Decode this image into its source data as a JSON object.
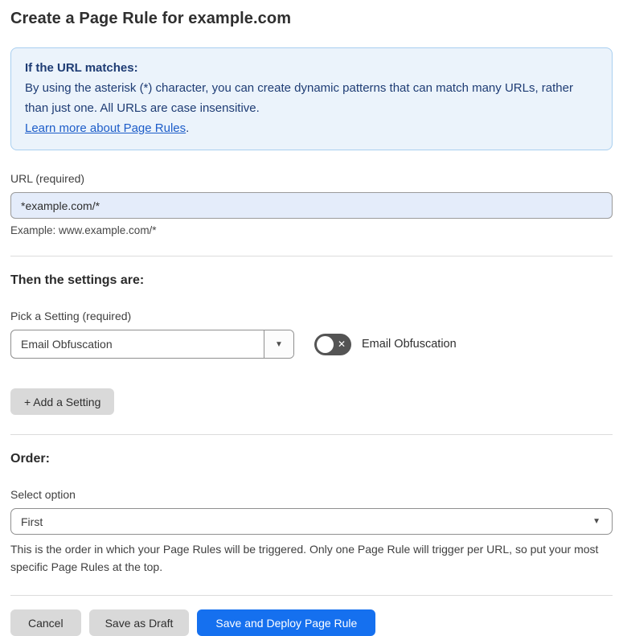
{
  "page": {
    "title": "Create a Page Rule for example.com"
  },
  "info_box": {
    "heading": "If the URL matches:",
    "body": "By using the asterisk (*) character, you can create dynamic patterns that can match many URLs, rather than just one. All URLs are case insensitive.",
    "link": "Learn more about Page Rules",
    "link_suffix": "."
  },
  "url_field": {
    "label": "URL (required)",
    "value": "*example.com/*",
    "helper": "Example: www.example.com/*"
  },
  "settings": {
    "heading": "Then the settings are:",
    "picker_label": "Pick a Setting (required)",
    "picker_value": "Email Obfuscation",
    "toggle_label": "Email Obfuscation",
    "toggle_state": "off",
    "add_button_label": "+ Add a Setting"
  },
  "order": {
    "heading": "Order:",
    "select_label": "Select option",
    "select_value": "First",
    "helper": "This is the order in which your Page Rules will be triggered. Only one Page Rule will trigger per URL, so put your most specific Page Rules at the top."
  },
  "footer": {
    "cancel_label": "Cancel",
    "save_draft_label": "Save as Draft",
    "save_deploy_label": "Save and Deploy Page Rule"
  },
  "icons": {
    "dropdown_arrow": "▼",
    "toggle_off_x": "✕"
  },
  "colors": {
    "accent_blue": "#1570EF",
    "info_bg": "#EBF3FB",
    "info_border": "#A9CFF0",
    "info_text": "#1E3C74",
    "link_blue": "#1D5DC9",
    "input_bg": "#E4ECFA",
    "toggle_off_bg": "#545454",
    "button_gray": "#D9D9D9"
  }
}
